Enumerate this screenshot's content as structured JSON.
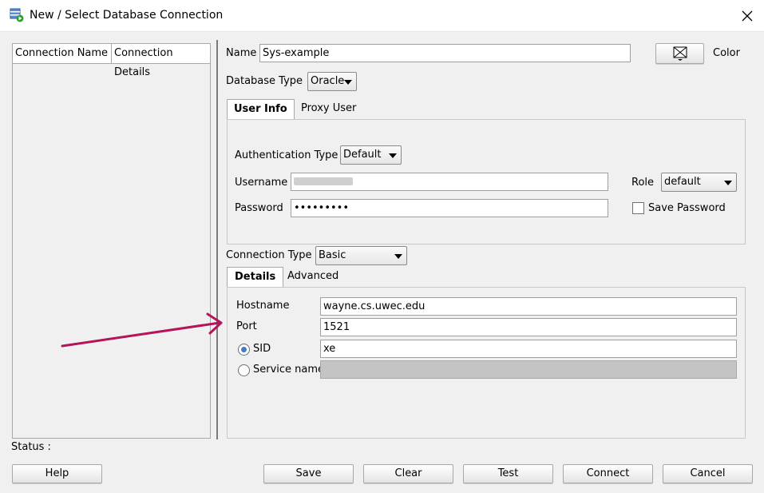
{
  "window": {
    "title": "New / Select Database Connection",
    "close_icon": "close-icon"
  },
  "connections_list": {
    "headers": [
      "Connection Name",
      "Connection Details"
    ]
  },
  "form": {
    "name_label": "Name",
    "name_value": "Sys-example",
    "color_label": "Color",
    "database_type_label": "Database Type",
    "database_type_value": "Oracle",
    "top_tabs": [
      "User Info",
      "Proxy User"
    ],
    "auth_type_label": "Authentication Type",
    "auth_type_value": "Default",
    "username_label": "Username",
    "password_label": "Password",
    "password_value": "•••••••••",
    "role_label": "Role",
    "role_value": "default",
    "save_password_label": "Save Password",
    "connection_type_label": "Connection Type",
    "connection_type_value": "Basic",
    "detail_tabs": [
      "Details",
      "Advanced"
    ],
    "hostname_label": "Hostname",
    "hostname_value": "wayne.cs.uwec.edu",
    "port_label": "Port",
    "port_value": "1521",
    "sid_label": "SID",
    "sid_value": "xe",
    "service_name_label": "Service name"
  },
  "status_label": "Status :",
  "buttons": {
    "help": "Help",
    "save": "Save",
    "clear": "Clear",
    "test": "Test",
    "connect": "Connect",
    "cancel": "Cancel"
  },
  "colors": {
    "annotation_arrow": "#b5135a",
    "radio_dot": "#4a78c4"
  }
}
